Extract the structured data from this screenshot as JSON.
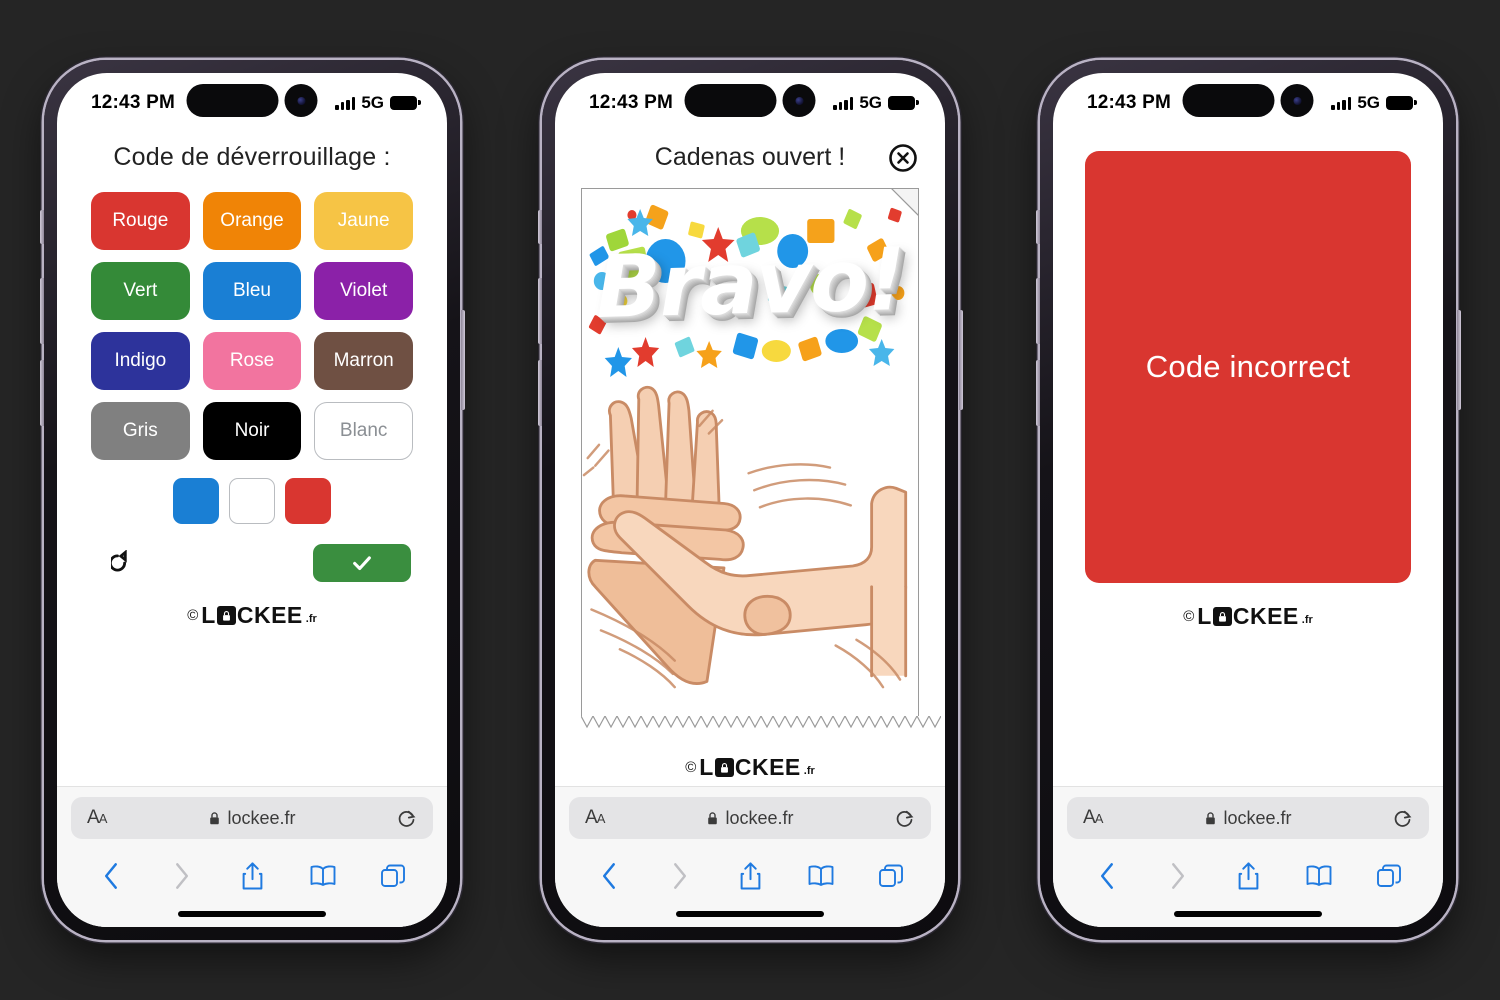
{
  "background_color": "#252525",
  "statusbar": {
    "time": "12:43 PM",
    "network": "5G",
    "signal_icon": "cellular-bars-icon",
    "battery_icon": "battery-full-icon"
  },
  "safari": {
    "aa_label": "AA",
    "lock_icon": "lock-icon",
    "url": "lockee.fr",
    "reload_icon": "reload-icon",
    "back_icon": "chevron-left-icon",
    "forward_icon": "chevron-right-icon",
    "share_icon": "share-icon",
    "bookmarks_icon": "book-icon",
    "tabs_icon": "tabs-icon"
  },
  "logo": {
    "copyright": "©",
    "text_before": "L",
    "lock_icon": "padlock-icon",
    "text_after": "CKEE",
    "suffix": ".fr"
  },
  "phone1": {
    "title": "Code de déverrouillage :",
    "colors": [
      {
        "label": "Rouge",
        "hex": "#d93630",
        "text": "#ffffff",
        "outlined": false
      },
      {
        "label": "Orange",
        "hex": "#f08406",
        "text": "#ffffff",
        "outlined": false
      },
      {
        "label": "Jaune",
        "hex": "#f6c445",
        "text": "#ffffff",
        "outlined": false
      },
      {
        "label": "Vert",
        "hex": "#348a38",
        "text": "#ffffff",
        "outlined": false
      },
      {
        "label": "Bleu",
        "hex": "#1a7fd4",
        "text": "#ffffff",
        "outlined": false
      },
      {
        "label": "Violet",
        "hex": "#8b21a8",
        "text": "#ffffff",
        "outlined": false
      },
      {
        "label": "Indigo",
        "hex": "#2d339b",
        "text": "#ffffff",
        "outlined": false
      },
      {
        "label": "Rose",
        "hex": "#f2749f",
        "text": "#ffffff",
        "outlined": false
      },
      {
        "label": "Marron",
        "hex": "#6f5043",
        "text": "#ffffff",
        "outlined": false
      },
      {
        "label": "Gris",
        "hex": "#808080",
        "text": "#ffffff",
        "outlined": false
      },
      {
        "label": "Noir",
        "hex": "#000000",
        "text": "#ffffff",
        "outlined": false
      },
      {
        "label": "Blanc",
        "hex": "#ffffff",
        "text": "#8b8f94",
        "outlined": true
      }
    ],
    "selected_code": [
      {
        "name": "Bleu",
        "hex": "#1a7fd4",
        "bordered": false
      },
      {
        "name": "Blanc",
        "hex": "#ffffff",
        "bordered": true
      },
      {
        "name": "Rouge",
        "hex": "#d93630",
        "bordered": false
      }
    ],
    "reset_icon": "reset-arrow-icon",
    "validate_icon": "checkmark-icon",
    "validate_color": "#3a8e3f"
  },
  "phone2": {
    "title": "Cadenas ouvert !",
    "close_icon": "close-circle-icon",
    "bravo_text": "Bravo!",
    "illustration": "clapping-hands-illustration",
    "confetti": "confetti-illustration"
  },
  "phone3": {
    "error_text": "Code incorrect",
    "error_color": "#d93630"
  }
}
